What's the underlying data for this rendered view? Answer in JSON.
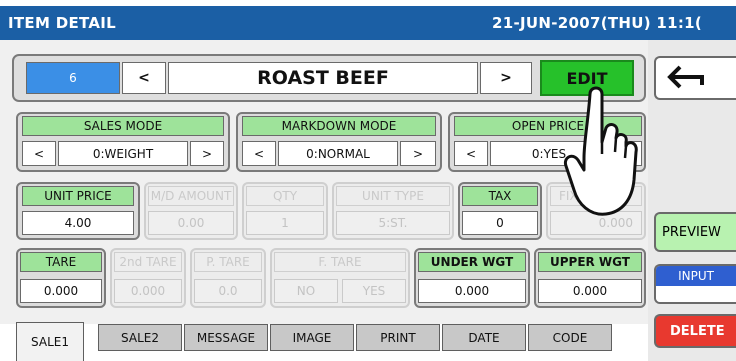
{
  "header": {
    "title": "ITEM DETAIL",
    "datetime": "21-JUN-2007(THU) 11:1("
  },
  "nav": {
    "item_number": "6",
    "prev": "<",
    "next": ">",
    "item_name": "ROAST BEEF",
    "edit_label": "EDIT"
  },
  "modes": {
    "sales_mode": {
      "label": "SALES MODE",
      "value": "0:WEIGHT"
    },
    "markdown_mode": {
      "label": "MARKDOWN MODE",
      "value": "0:NORMAL"
    },
    "open_price": {
      "label": "OPEN PRICE",
      "value": "0:YES"
    },
    "prev": "<",
    "next": ">"
  },
  "fields_row1": {
    "unit_price": {
      "label": "UNIT PRICE",
      "value": "4.00"
    },
    "md_amount": {
      "label": "M/D AMOUNT",
      "value": "0.00"
    },
    "qty": {
      "label": "QTY",
      "value": "1"
    },
    "unit_type": {
      "label": "UNIT TYPE",
      "value": "5:ST."
    },
    "tax": {
      "label": "TAX",
      "value": "0"
    },
    "fixed": {
      "label": "FIXED",
      "value": "0.000"
    }
  },
  "fields_row2": {
    "tare": {
      "label": "TARE",
      "value": "0.000"
    },
    "second_tare": {
      "label": "2nd TARE",
      "value": "0.000"
    },
    "p_tare": {
      "label": "P. TARE",
      "value": "0.0"
    },
    "f_tare": {
      "label": "F. TARE",
      "no": "NO",
      "yes": "YES"
    },
    "under_wgt": {
      "label": "UNDER WGT",
      "value": "0.000"
    },
    "upper_wgt": {
      "label": "UPPER WGT",
      "value": "0.000"
    }
  },
  "tabs": [
    "SALE1",
    "SALE2",
    "MESSAGE",
    "IMAGE",
    "PRINT",
    "DATE",
    "CODE"
  ],
  "side": {
    "preview": "PREVIEW",
    "input": "INPUT",
    "delete": "DELETE"
  },
  "colors": {
    "title_bg": "#1b5fa5",
    "label_green": "#9ee39a",
    "edit_green": "#26c12a",
    "delete_red": "#e8392f",
    "item_no_blue": "#3b8fe6"
  },
  "icons": [
    "back-arrow-icon",
    "pointing-hand-icon"
  ]
}
